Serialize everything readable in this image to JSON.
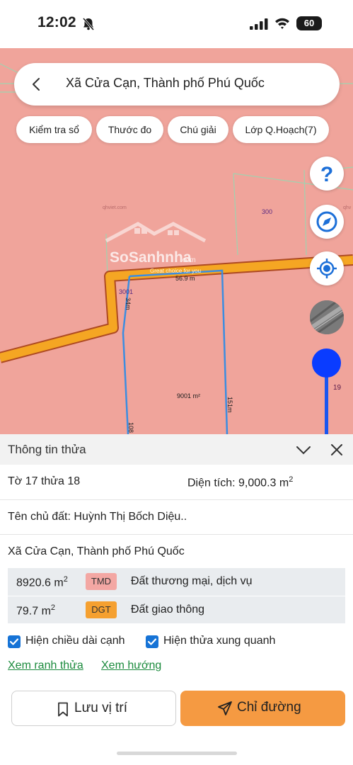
{
  "status_bar": {
    "time": "12:02",
    "battery": "60"
  },
  "search": {
    "title": "Xã Cửa Cạn, Thành phố Phú Quốc"
  },
  "chips": [
    "Kiểm tra sổ",
    "Thước đo",
    "Chú giải",
    "Lớp Q.Hoạch(7)"
  ],
  "map": {
    "labels": {
      "parcel_300": "300",
      "parcel_3001": "3001",
      "edge_top": "56.9 m",
      "edge_left": "34m",
      "edge_right": "151m",
      "edge_bottom_left": "108",
      "area": "9001 m²",
      "watermark_small_1": "qhviet.com",
      "watermark_small_2": "qhv",
      "watermark_brand": "SoSanhnha",
      "watermark_domain": ".com",
      "watermark_tagline": "Great choice for you"
    },
    "slider_value": "19",
    "colors": {
      "map_bg": "#f0a49b",
      "road": "#f5a623",
      "boundary": "#3c8de0",
      "accent": "#0a3cff"
    }
  },
  "sheet": {
    "title": "Thông tin thửa",
    "parcel": "Tờ 17 thửa 18",
    "area_label": "Diện tích: 9,000.3 m",
    "area_sup": "2",
    "owner": "Tên chủ đất: Huỳnh Thị Bốch Diệu..",
    "address": "Xã Cửa Cạn, Thành phố Phú Quốc",
    "land_uses": [
      {
        "area": "8920.6 m",
        "sup": "2",
        "code": "TMD",
        "desc": "Đất thương mại, dịch vụ",
        "color": "#f3a7a3"
      },
      {
        "area": "79.7 m",
        "sup": "2",
        "code": "DGT",
        "desc": "Đất giao thông",
        "color": "#f5a030"
      }
    ],
    "checkbox_lengths": "Hiện chiều dài cạnh",
    "checkbox_neighbors": "Hiện thửa xung quanh",
    "link_boundary": "Xem ranh thửa",
    "link_direction": "Xem hướng",
    "save_label": "Lưu vị trí",
    "direction_label": "Chỉ đường"
  }
}
